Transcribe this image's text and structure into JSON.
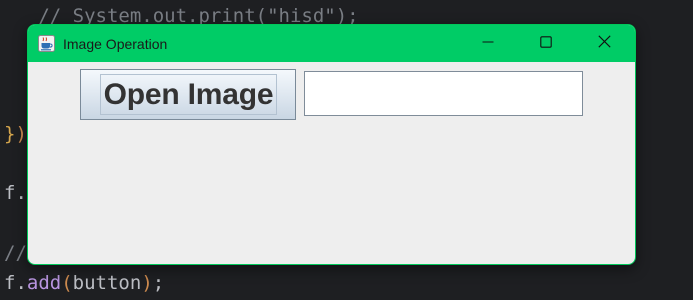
{
  "editor": {
    "line1": "   // System.out.print(\"hisd\");",
    "line2_brace": "}",
    "line2_paren": ")",
    "line3": "f.",
    "line4": "//",
    "line5_obj": "f.",
    "line5_method": "add",
    "line5_open": "(",
    "line5_arg": "button",
    "line5_close": ")",
    "line5_end": ";"
  },
  "window": {
    "title": "Image Operation",
    "app_icon": "java-cup-icon",
    "controls": {
      "minimize": "minimize-icon",
      "maximize": "maximize-icon",
      "close": "close-icon"
    },
    "accent": "#00cc66"
  },
  "content": {
    "open_button_label": "Open Image",
    "text_field_value": "",
    "text_field_placeholder": ""
  }
}
